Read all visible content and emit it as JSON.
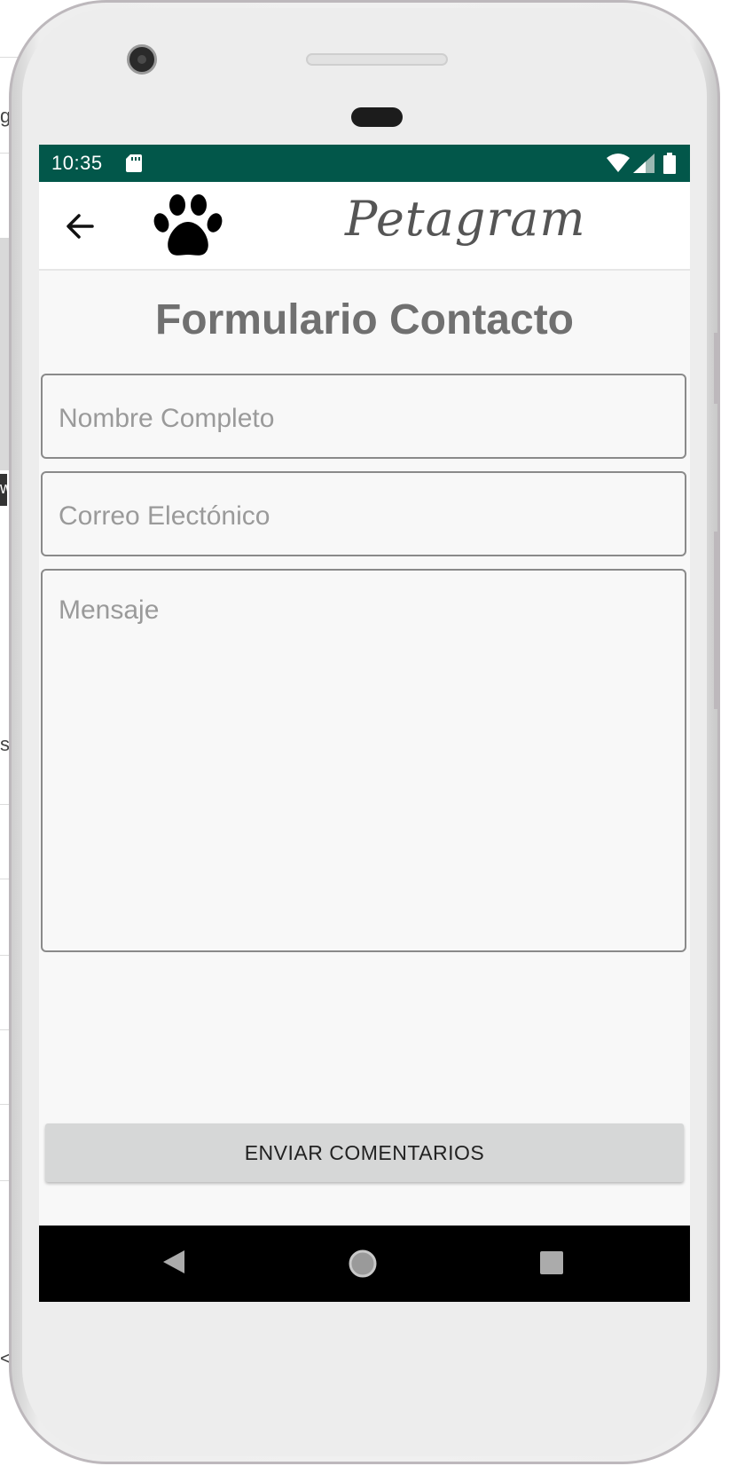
{
  "status_bar": {
    "time": "10:35",
    "icons": [
      "sd-card-icon",
      "wifi-icon",
      "cell-signal-icon",
      "battery-icon"
    ],
    "background": "#02574a"
  },
  "toolbar": {
    "back_icon": "arrow-left-icon",
    "logo_icon": "paw-icon",
    "brand": "Petagram"
  },
  "form": {
    "title": "Formulario Contacto",
    "name_placeholder": "Nombre Completo",
    "email_placeholder": "Correo Electónico",
    "message_placeholder": "Mensaje",
    "submit_label": "ENVIAR COMENTARIOS"
  },
  "nav_bar": {
    "icons": [
      "triangle-back-icon",
      "circle-home-icon",
      "square-recents-icon"
    ]
  },
  "background_window": {
    "fragments": [
      "g",
      "w",
      "st",
      "< + C"
    ]
  }
}
